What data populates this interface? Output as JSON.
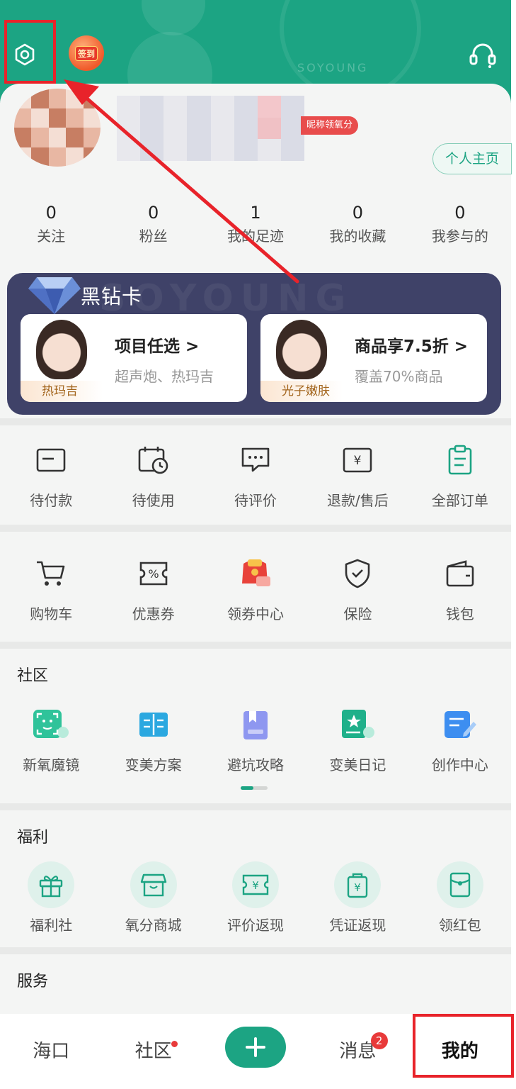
{
  "header": {
    "brand": "SOYOUNG",
    "signin_label": "签到",
    "accent": "#1ca483"
  },
  "profile": {
    "nick_tag": "昵称领氧分",
    "home_button": "个人主页"
  },
  "stats": [
    {
      "num": "0",
      "label": "关注"
    },
    {
      "num": "0",
      "label": "粉丝"
    },
    {
      "num": "1",
      "label": "我的足迹"
    },
    {
      "num": "0",
      "label": "我的收藏"
    },
    {
      "num": "0",
      "label": "我参与的"
    }
  ],
  "vip": {
    "title": "黑钻卡",
    "watermark": "SOYOUNG",
    "items": [
      {
        "title": "项目任选 >",
        "subtitle": "超声炮、热玛吉",
        "tag": "热玛吉"
      },
      {
        "title": "商品享7.5折 >",
        "subtitle": "覆盖70%商品",
        "tag": "光子嫩肤"
      }
    ]
  },
  "orders": [
    {
      "label": "待付款",
      "icon": "card-icon"
    },
    {
      "label": "待使用",
      "icon": "calendar-clock-icon"
    },
    {
      "label": "待评价",
      "icon": "comment-icon"
    },
    {
      "label": "退款/售后",
      "icon": "refund-icon"
    },
    {
      "label": "全部订单",
      "icon": "clipboard-icon"
    }
  ],
  "tools": [
    {
      "label": "购物车",
      "icon": "cart-icon"
    },
    {
      "label": "优惠券",
      "icon": "coupon-icon"
    },
    {
      "label": "领券中心",
      "icon": "red-packet-icon"
    },
    {
      "label": "保险",
      "icon": "shield-icon"
    },
    {
      "label": "钱包",
      "icon": "wallet-icon"
    }
  ],
  "community": {
    "title": "社区",
    "items": [
      {
        "label": "新氧魔镜",
        "icon": "face-scan-icon"
      },
      {
        "label": "变美方案",
        "icon": "book-icon"
      },
      {
        "label": "避坑攻略",
        "icon": "bookmark-icon"
      },
      {
        "label": "变美日记",
        "icon": "diary-star-icon"
      },
      {
        "label": "创作中心",
        "icon": "edit-icon"
      }
    ]
  },
  "welfare": {
    "title": "福利",
    "items": [
      {
        "label": "福利社",
        "icon": "gift-icon"
      },
      {
        "label": "氧分商城",
        "icon": "shop-icon"
      },
      {
        "label": "评价返现",
        "icon": "yen-ticket-icon"
      },
      {
        "label": "凭证返现",
        "icon": "yen-bag-icon"
      },
      {
        "label": "领红包",
        "icon": "red-envelope-icon"
      }
    ]
  },
  "service": {
    "title": "服务"
  },
  "tabbar": {
    "tabs": [
      "海口",
      "社区",
      "",
      "消息",
      "我的"
    ],
    "message_badge": "2"
  }
}
